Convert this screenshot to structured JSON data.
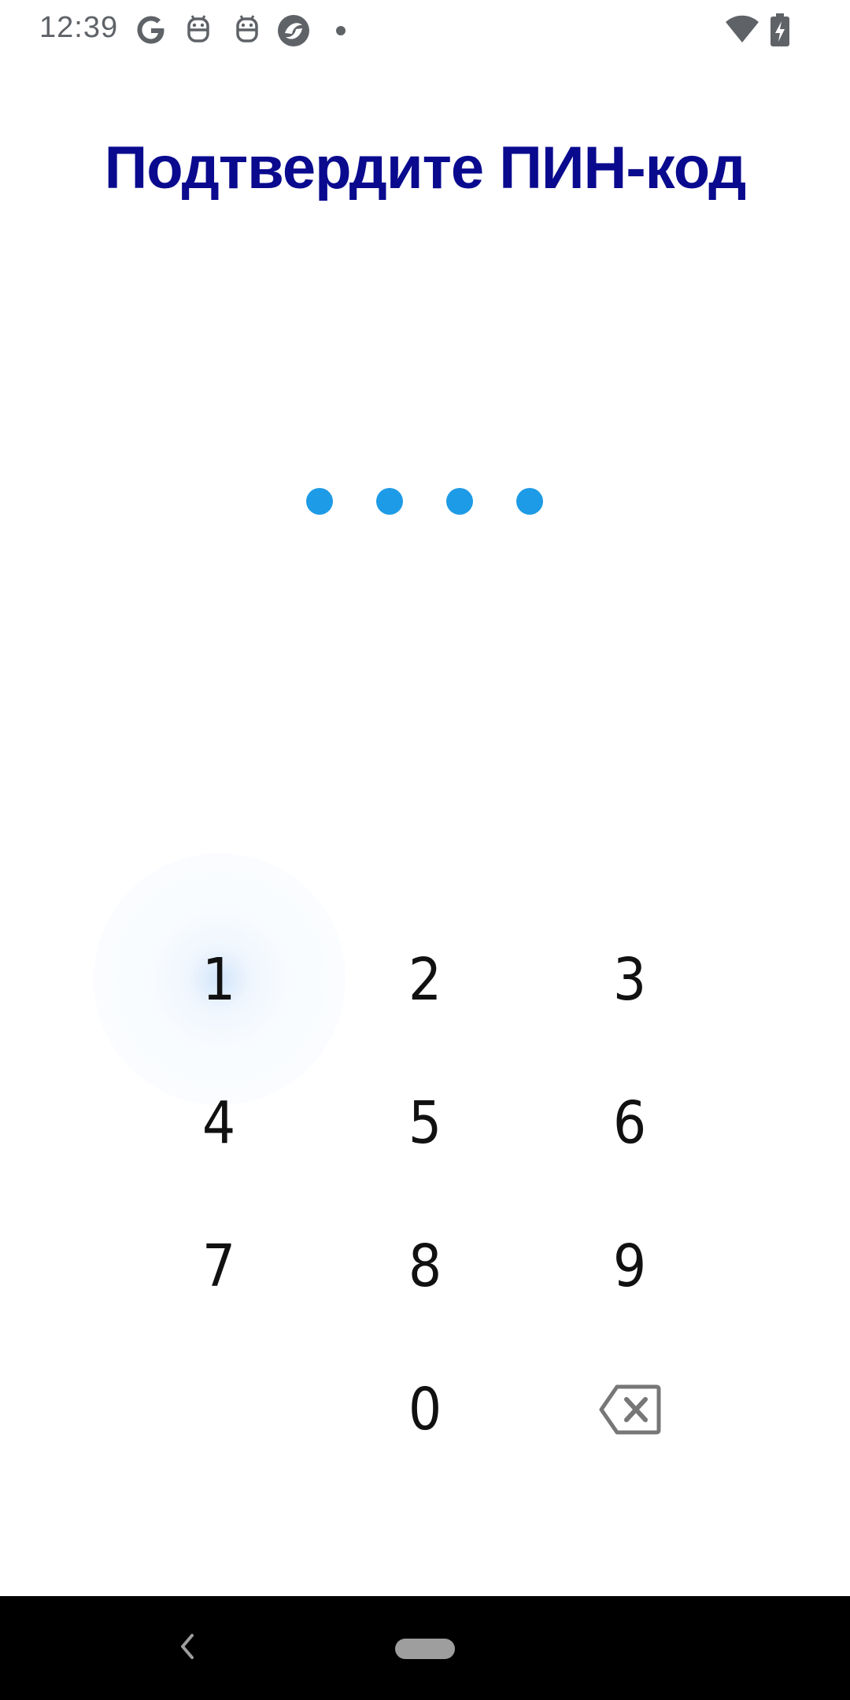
{
  "status_bar": {
    "time": "12:39",
    "notification_icons": [
      "google-icon",
      "android-icon",
      "android-icon",
      "app-icon",
      "more-dot-icon"
    ],
    "system_icons": [
      "wifi-icon",
      "battery-charging-icon"
    ]
  },
  "screen": {
    "title": "Подтвердите ПИН-код",
    "pin_length": 4,
    "pin_entered": 4
  },
  "keypad": {
    "keys": [
      "1",
      "2",
      "3",
      "4",
      "5",
      "6",
      "7",
      "8",
      "9",
      "0"
    ],
    "pressed_key": "1",
    "backspace_icon": "backspace-icon"
  },
  "navigation": {
    "back_icon": "back-chevron-icon",
    "home_icon": "home-pill-icon"
  },
  "colors": {
    "title": "#0a0a8f",
    "pin_dot": "#1e9be6",
    "key_text": "#111111",
    "icon_gray": "#5f6368",
    "nav_bar": "#000000"
  }
}
